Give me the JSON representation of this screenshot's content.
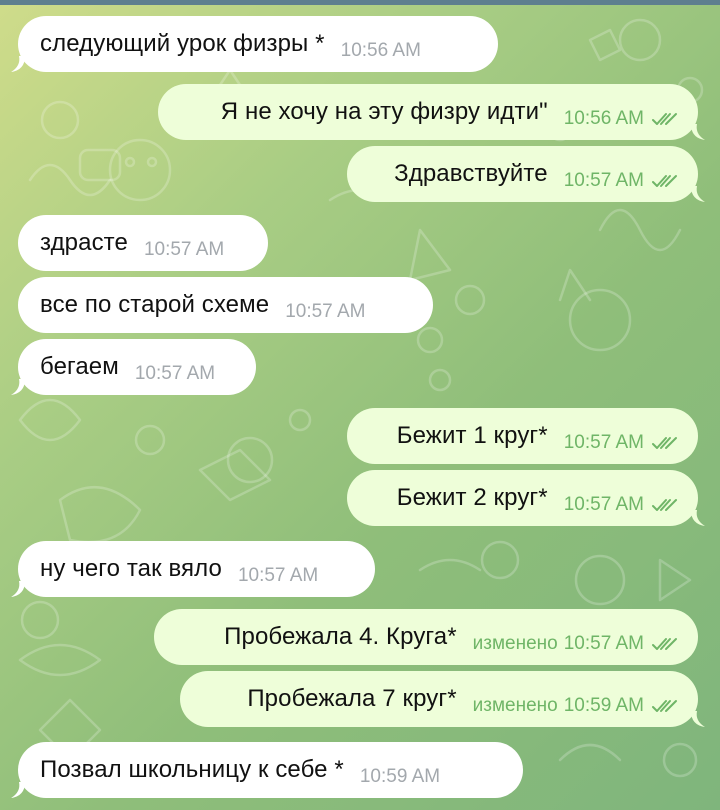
{
  "colors": {
    "incoming_bubble": "#ffffff",
    "outgoing_bubble": "#eefed9",
    "incoming_time": "#a3a8ad",
    "outgoing_time": "#6fb567",
    "wallpaper_start": "#cfdc8a",
    "wallpaper_end": "#7fb57c"
  },
  "messages": [
    {
      "direction": "incoming",
      "text": "следующий урок физры *",
      "time": "10:56 AM"
    },
    {
      "direction": "outgoing",
      "text": "Я не хочу на эту физру идти\"",
      "time": "10:56 AM",
      "status": "read-double-check-icon"
    },
    {
      "direction": "outgoing",
      "text": "Здравствуйте",
      "time": "10:57 AM",
      "status": "read-double-check-icon"
    },
    {
      "direction": "incoming",
      "text": "здрасте",
      "time": "10:57 AM"
    },
    {
      "direction": "incoming",
      "text": "все по старой схеме",
      "time": "10:57 AM"
    },
    {
      "direction": "incoming",
      "text": "бегаем",
      "time": "10:57 AM"
    },
    {
      "direction": "outgoing",
      "text": "Бежит 1 круг*",
      "time": "10:57 AM",
      "status": "read-double-check-icon"
    },
    {
      "direction": "outgoing",
      "text": "Бежит 2 круг*",
      "time": "10:57 AM",
      "status": "read-double-check-icon"
    },
    {
      "direction": "incoming",
      "text": "ну чего так вяло",
      "time": "10:57 AM"
    },
    {
      "direction": "outgoing",
      "text": "Пробежала 4. Круга*",
      "edited": "изменено",
      "time": "10:57 AM",
      "status": "read-double-check-icon"
    },
    {
      "direction": "outgoing",
      "text": "Пробежала 7 круг*",
      "edited": "изменено",
      "time": "10:59 AM",
      "status": "read-double-check-icon"
    },
    {
      "direction": "incoming",
      "text": "Позвал школьницу к себе *",
      "time": "10:59 AM"
    }
  ]
}
